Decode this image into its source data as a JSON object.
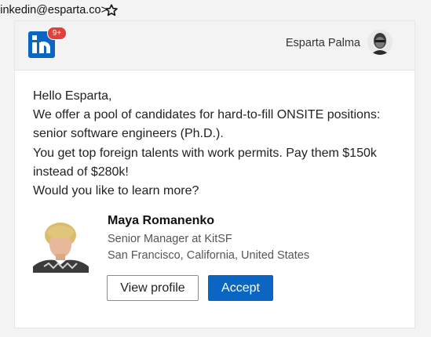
{
  "sender": {
    "address": "linkedin@esparta.co>",
    "star_icon": "star-icon"
  },
  "header": {
    "brand": "in",
    "notification_count": "9+",
    "user_name": "Esparta Palma"
  },
  "message": {
    "lines": [
      "Hello Esparta,",
      "We offer a pool of candidates for hard-to-fill ONSITE positions:",
      "senior software engineers (Ph.D.).",
      "You get top foreign talents with work permits. Pay them $150k",
      "instead of $280k!",
      "Would you like to learn more?"
    ]
  },
  "contact": {
    "name": "Maya Romanenko",
    "title": "Senior Manager at KitSF",
    "location": "San Francisco, California, United States"
  },
  "actions": {
    "view_profile": "View profile",
    "accept": "Accept"
  },
  "colors": {
    "brand": "#0a66c2",
    "badge": "#e2403a",
    "background": "#f3f3f3"
  }
}
